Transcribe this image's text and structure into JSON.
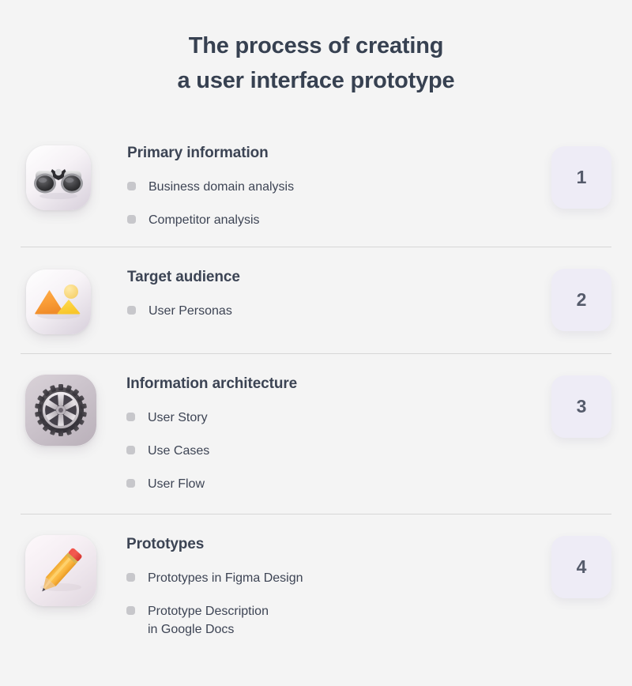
{
  "title": {
    "line1": "The process of creating",
    "line2": "a user interface prototype"
  },
  "colors": {
    "background": "#f4f4f4",
    "heading_text": "#3c4454",
    "body_text": "#3d4454",
    "bullet_dot": "#c7c7cb",
    "divider": "#d6d6d6",
    "badge_background": "#eeecf6",
    "badge_text": "#555b6b"
  },
  "steps": [
    {
      "number": "1",
      "icon": "binoculars-icon",
      "heading": "Primary information",
      "bullets": [
        "Business domain analysis",
        "Competitor analysis"
      ]
    },
    {
      "number": "2",
      "icon": "mountains-image-icon",
      "heading": "Target audience",
      "bullets": [
        "User Personas"
      ]
    },
    {
      "number": "3",
      "icon": "gear-icon",
      "heading": "Information architecture",
      "bullets": [
        "User Story",
        "Use Cases",
        "User Flow"
      ]
    },
    {
      "number": "4",
      "icon": "pencil-icon",
      "heading": "Prototypes",
      "bullets": [
        "Prototypes in Figma Design",
        "Prototype Description\nin Google Docs"
      ]
    }
  ]
}
